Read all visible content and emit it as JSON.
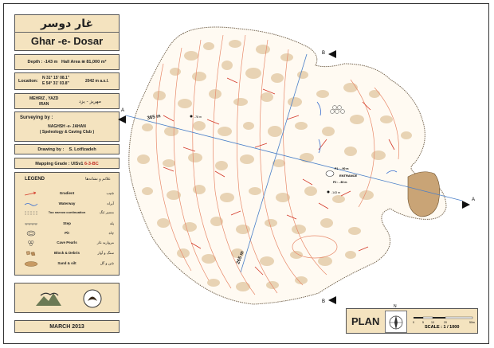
{
  "title_fa": "غار دوسر",
  "title_en": "Ghar -e- Dosar",
  "depth_label": "Depth : -143 m",
  "hall_area_label": "Hall Area ≅ 81,000 m²",
  "location": {
    "label": "Location:",
    "lat": "N 31° 15' 08.1\"",
    "lon": "E 54° 31' 03.8\"",
    "altitude": "2042 m a.s.l."
  },
  "place": {
    "line1": "MEHRIZ , YAZD",
    "line2": "IRAN",
    "fa": "مهریز - یزد"
  },
  "surveying": {
    "heading": "Surveying by :",
    "team": "NAGHSH -e- JAHAN",
    "club": "( Speleology & Caving Club )"
  },
  "drawing": {
    "label": "Drawing by :",
    "name": "S. Lotfizadeh"
  },
  "grade": {
    "label": "Mapping Grade : UISv1",
    "value": "6-3-BC"
  },
  "legend": {
    "heading": "LEGEND",
    "heading_fa": "علائم و نشانه‌ها",
    "items": [
      {
        "name": "Gradient",
        "fa": "شیب"
      },
      {
        "name": "Waterway",
        "fa": "آبراه"
      },
      {
        "name": "Too narrow continuation",
        "fa": "مسیر تنگ"
      },
      {
        "name": "Step",
        "fa": "پله"
      },
      {
        "name": "Pit",
        "fa": "چاه"
      },
      {
        "name": "Cave Pearls",
        "fa": "مروارید غار"
      },
      {
        "name": "Block & Debris",
        "fa": "سنگ و آوار"
      },
      {
        "name": "Sand & silt",
        "fa": "شن و گل"
      }
    ]
  },
  "date": "MARCH 2013",
  "map": {
    "section_a": "A",
    "section_b": "B",
    "dim_365": "365 m",
    "dim_265": "265 m",
    "p1_label": "P1 : - 90 m",
    "entrance_label": "ENTRANCE",
    "p2_label": "P2 : - 80 m",
    "p3_label": "-143 m",
    "p4_label": "-78 m"
  },
  "plan": {
    "label": "PLAN",
    "north": "N",
    "scale": "SCALE : 1 / 1000",
    "scale_ticks": [
      "0",
      "5",
      "10",
      "20",
      "50m"
    ]
  }
}
